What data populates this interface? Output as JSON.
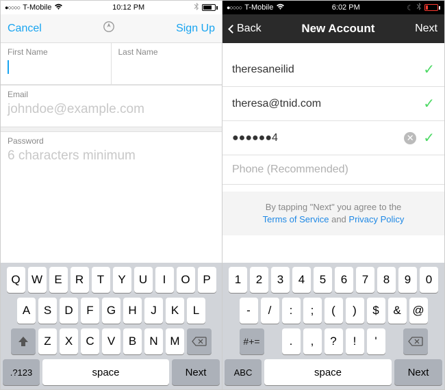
{
  "left": {
    "status": {
      "carrier": "T-Mobile",
      "time": "10:12 PM"
    },
    "nav": {
      "cancel": "Cancel",
      "signup": "Sign Up"
    },
    "fields": {
      "fn_label": "First Name",
      "ln_label": "Last Name",
      "email_label": "Email",
      "email_placeholder": "johndoe@example.com",
      "pw_label": "Password",
      "pw_placeholder": "6 characters minimum"
    },
    "keyboard": {
      "r1": [
        "Q",
        "W",
        "E",
        "R",
        "T",
        "Y",
        "U",
        "I",
        "O",
        "P"
      ],
      "r2": [
        "A",
        "S",
        "D",
        "F",
        "G",
        "H",
        "J",
        "K",
        "L"
      ],
      "r3": [
        "Z",
        "X",
        "C",
        "V",
        "B",
        "N",
        "M"
      ],
      "mode": ".?123",
      "space": "space",
      "next": "Next"
    }
  },
  "right": {
    "status": {
      "carrier": "T-Mobile",
      "time": "6:02 PM"
    },
    "nav": {
      "back": "Back",
      "title": "New Account",
      "next": "Next"
    },
    "rows": {
      "username": "theresaneilid",
      "email": "theresa@tnid.com",
      "password": "●●●●●●4",
      "phone_placeholder": "Phone (Recommended)"
    },
    "agree": {
      "line1": "By tapping \"Next\" you agree to the",
      "tos": "Terms of Service",
      "and": " and ",
      "pp": "Privacy Policy"
    },
    "keyboard": {
      "r1": [
        "1",
        "2",
        "3",
        "4",
        "5",
        "6",
        "7",
        "8",
        "9",
        "0"
      ],
      "r2": [
        "-",
        "/",
        ":",
        ";",
        "(",
        ")",
        "$",
        "&",
        "@"
      ],
      "sym": "#+=",
      "r3": [
        ".",
        ",",
        "?",
        "!",
        "'"
      ],
      "mode": "ABC",
      "space": "space",
      "next": "Next"
    }
  }
}
